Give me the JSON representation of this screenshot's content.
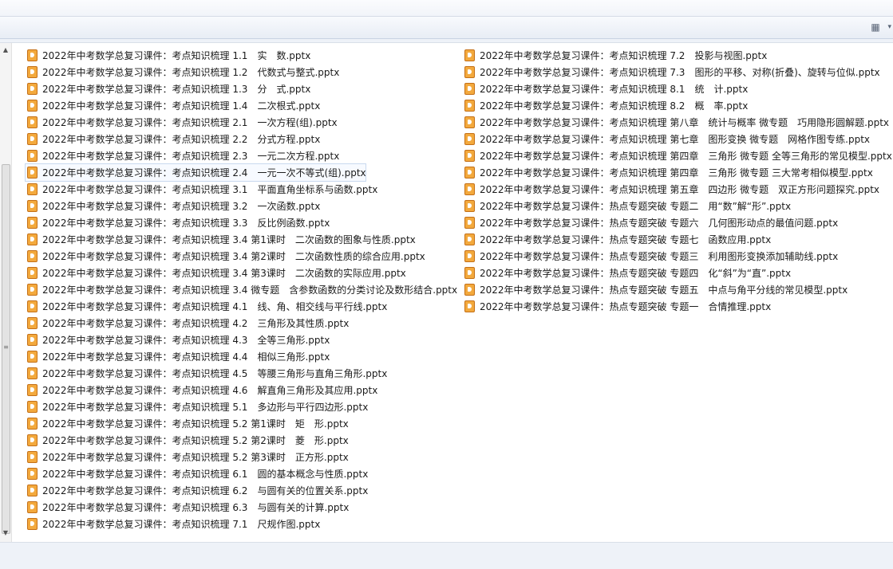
{
  "toolbar": {
    "view_icon": "view-options-icon"
  },
  "files_left": [
    "2022年中考数学总复习课件：考点知识梳理 1.1　实　数.pptx",
    "2022年中考数学总复习课件：考点知识梳理 1.2　代数式与整式.pptx",
    "2022年中考数学总复习课件：考点知识梳理 1.3　分　式.pptx",
    "2022年中考数学总复习课件：考点知识梳理 1.4　二次根式.pptx",
    "2022年中考数学总复习课件：考点知识梳理 2.1　一次方程(组).pptx",
    "2022年中考数学总复习课件：考点知识梳理 2.2　分式方程.pptx",
    "2022年中考数学总复习课件：考点知识梳理 2.3　一元二次方程.pptx",
    "2022年中考数学总复习课件：考点知识梳理 2.4　一元一次不等式(组).pptx",
    "2022年中考数学总复习课件：考点知识梳理 3.1　平面直角坐标系与函数.pptx",
    "2022年中考数学总复习课件：考点知识梳理 3.2　一次函数.pptx",
    "2022年中考数学总复习课件：考点知识梳理 3.3　反比例函数.pptx",
    "2022年中考数学总复习课件：考点知识梳理 3.4 第1课时　二次函数的图象与性质.pptx",
    "2022年中考数学总复习课件：考点知识梳理 3.4 第2课时　二次函数性质的综合应用.pptx",
    "2022年中考数学总复习课件：考点知识梳理 3.4 第3课时　二次函数的实际应用.pptx",
    "2022年中考数学总复习课件：考点知识梳理 3.4 微专题　含参数函数的分类讨论及数形结合.pptx",
    "2022年中考数学总复习课件：考点知识梳理 4.1　线、角、相交线与平行线.pptx",
    "2022年中考数学总复习课件：考点知识梳理 4.2　三角形及其性质.pptx",
    "2022年中考数学总复习课件：考点知识梳理 4.3　全等三角形.pptx",
    "2022年中考数学总复习课件：考点知识梳理 4.4　相似三角形.pptx",
    "2022年中考数学总复习课件：考点知识梳理 4.5　等腰三角形与直角三角形.pptx",
    "2022年中考数学总复习课件：考点知识梳理 4.6　解直角三角形及其应用.pptx",
    "2022年中考数学总复习课件：考点知识梳理 5.1　多边形与平行四边形.pptx",
    "2022年中考数学总复习课件：考点知识梳理 5.2 第1课时　矩　形.pptx",
    "2022年中考数学总复习课件：考点知识梳理 5.2 第2课时　菱　形.pptx",
    "2022年中考数学总复习课件：考点知识梳理 5.2 第3课时　正方形.pptx",
    "2022年中考数学总复习课件：考点知识梳理 6.1　圆的基本概念与性质.pptx",
    "2022年中考数学总复习课件：考点知识梳理 6.2　与圆有关的位置关系.pptx",
    "2022年中考数学总复习课件：考点知识梳理 6.3　与圆有关的计算.pptx",
    "2022年中考数学总复习课件：考点知识梳理 7.1　尺规作图.pptx"
  ],
  "files_right": [
    "2022年中考数学总复习课件：考点知识梳理 7.2　投影与视图.pptx",
    "2022年中考数学总复习课件：考点知识梳理 7.3　图形的平移、对称(折叠)、旋转与位似.pptx",
    "2022年中考数学总复习课件：考点知识梳理 8.1　统　计.pptx",
    "2022年中考数学总复习课件：考点知识梳理 8.2　概　率.pptx",
    "2022年中考数学总复习课件：考点知识梳理 第八章　统计与概率 微专题　巧用隐形圆解题.pptx",
    "2022年中考数学总复习课件：考点知识梳理 第七章　图形变换 微专题　网格作图专练.pptx",
    "2022年中考数学总复习课件：考点知识梳理 第四章　三角形 微专题 全等三角形的常见模型.pptx",
    "2022年中考数学总复习课件：考点知识梳理 第四章　三角形 微专题 三大常考相似模型.pptx",
    "2022年中考数学总复习课件：考点知识梳理 第五章　四边形 微专题　双正方形问题探究.pptx",
    "2022年中考数学总复习课件：热点专题突破 专题二　用“数”解“形”.pptx",
    "2022年中考数学总复习课件：热点专题突破 专题六　几何图形动点的最值问题.pptx",
    "2022年中考数学总复习课件：热点专题突破 专题七　函数应用.pptx",
    "2022年中考数学总复习课件：热点专题突破 专题三　利用图形变换添加辅助线.pptx",
    "2022年中考数学总复习课件：热点专题突破 专题四　化“斜”为“直”.pptx",
    "2022年中考数学总复习课件：热点专题突破 专题五　中点与角平分线的常见模型.pptx",
    "2022年中考数学总复习课件：热点专题突破 专题一　合情推理.pptx"
  ],
  "focused_index_left": 7,
  "file_icon": "pptx-file-icon",
  "colors": {
    "icon_fill": "#f3a93d",
    "icon_border": "#c46f16",
    "focus_border": "#c9d9ef"
  }
}
